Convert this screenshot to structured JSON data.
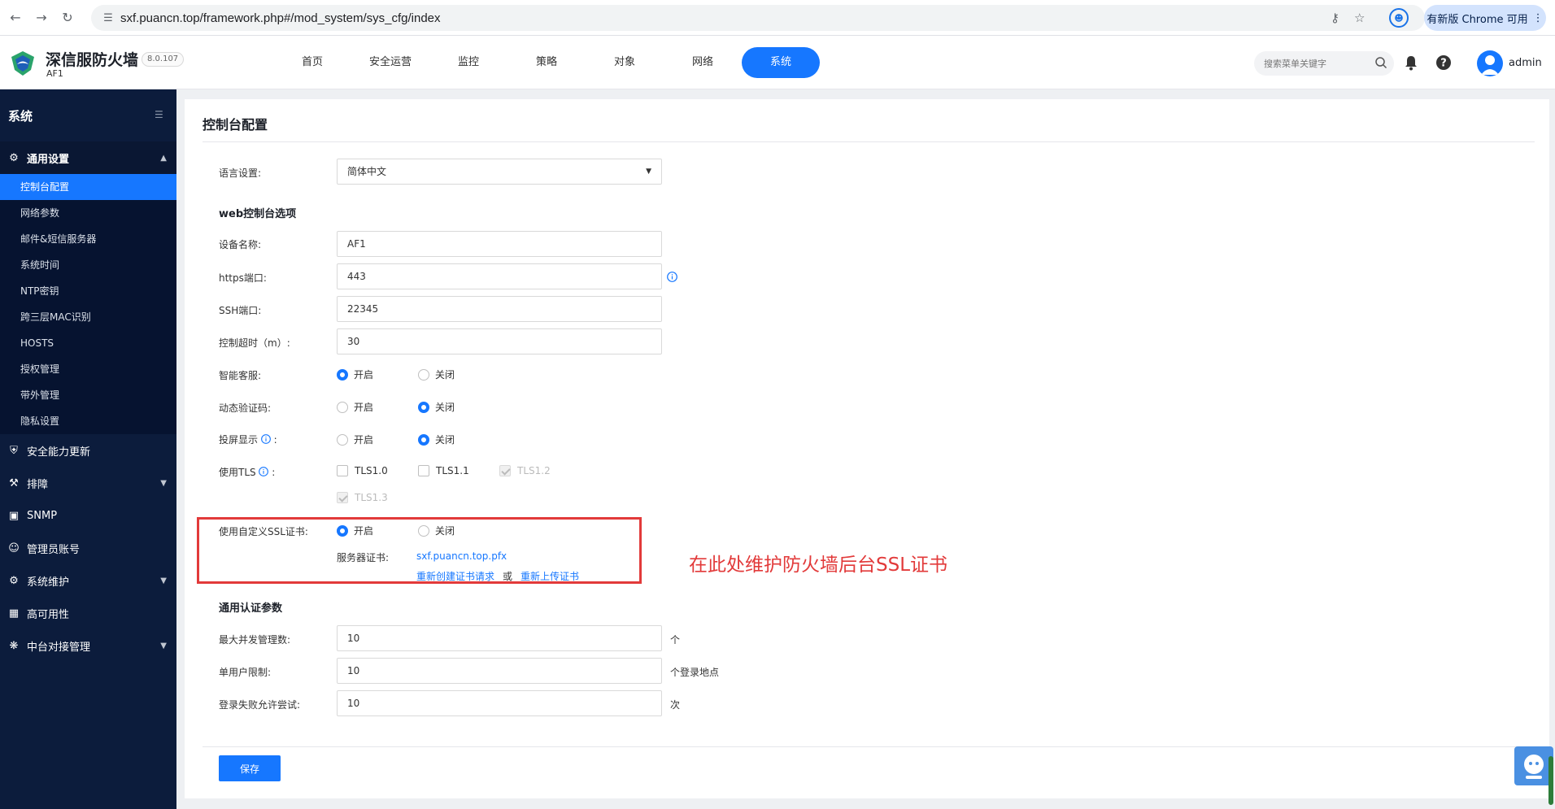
{
  "browser": {
    "url": "sxf.puancn.top/framework.php#/mod_system/sys_cfg/index",
    "update_label": "有新版 Chrome 可用"
  },
  "header": {
    "brand_name": "深信服防火墙",
    "brand_sub": "AF1",
    "version": "8.0.107",
    "nav": [
      "首页",
      "安全运营",
      "监控",
      "策略",
      "对象",
      "网络",
      "系统"
    ],
    "active_nav_index": 6,
    "search_placeholder": "搜索菜单关键字",
    "user": "admin"
  },
  "sidebar": {
    "title": "系统",
    "groups": [
      {
        "label": "通用设置",
        "icon": "gear-icon",
        "open": true
      },
      {
        "label": "安全能力更新",
        "icon": "shield-icon"
      },
      {
        "label": "排障",
        "icon": "wrench-icon"
      },
      {
        "label": "SNMP",
        "icon": "snmp-icon"
      },
      {
        "label": "管理员账号",
        "icon": "user-icon"
      },
      {
        "label": "系统维护",
        "icon": "gear-icon"
      },
      {
        "label": "高可用性",
        "icon": "chart-icon"
      },
      {
        "label": "中台对接管理",
        "icon": "network-icon"
      }
    ],
    "sub_items": [
      "控制台配置",
      "网络参数",
      "邮件&短信服务器",
      "系统时间",
      "NTP密钥",
      "跨三层MAC识别",
      "HOSTS",
      "授权管理",
      "带外管理",
      "隐私设置"
    ]
  },
  "form": {
    "page_title": "控制台配置",
    "language_label": "语言设置:",
    "language_value": "简体中文",
    "web_section": "web控制台选项",
    "device_name_label": "设备名称:",
    "device_name_value": "AF1",
    "https_port_label": "https端口:",
    "https_port_value": "443",
    "ssh_port_label": "SSH端口:",
    "ssh_port_value": "22345",
    "timeout_label": "控制超时（m）:",
    "timeout_value": "30",
    "smart_service_label": "智能客服:",
    "dynamic_captcha_label": "动态验证码:",
    "screen_cast_label": "投屏显示",
    "tls_label": "使用TLS",
    "tls_options": [
      "TLS1.0",
      "TLS1.1",
      "TLS1.2",
      "TLS1.3"
    ],
    "custom_ssl_label": "使用自定义SSL证书:",
    "on_label": "开启",
    "off_label": "关闭",
    "colon": ":",
    "server_cert_label": "服务器证书:",
    "server_cert_file": "sxf.puancn.top.pfx",
    "recreate_cert_link": "重新创建证书请求",
    "or_text": "或",
    "reupload_cert_link": "重新上传证书",
    "annotation": "在此处维护防火墙后台SSL证书",
    "auth_section": "通用认证参数",
    "max_concurrent_label": "最大并发管理数:",
    "max_concurrent_value": "10",
    "max_concurrent_unit": "个",
    "single_user_label": "单用户限制:",
    "single_user_value": "10",
    "single_user_unit": "个登录地点",
    "login_fail_label": "登录失败允许尝试:",
    "login_fail_value": "10",
    "login_fail_unit": "次",
    "save_label": "保存"
  },
  "colors": {
    "primary": "#1677ff",
    "sidebar_bg": "#0c1c3c",
    "annotation_red": "#e23a3a"
  }
}
